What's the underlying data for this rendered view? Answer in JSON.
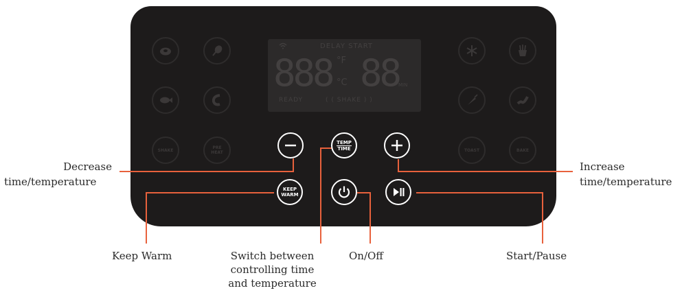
{
  "lcd": {
    "delay_start": "DELAY START",
    "temp_digits": "888",
    "unit_f": "°F",
    "unit_c": "°C",
    "time_digits": "88",
    "min": "MIN",
    "ready": "READY",
    "shake": "( ( SHAKE ) )"
  },
  "presets": {
    "shake": "SHAKE",
    "preheat_line1": "PRE",
    "preheat_line2": "HEAT",
    "toast": "TOAST",
    "bake": "BAKE"
  },
  "buttons": {
    "temp": "TEMP",
    "time": "TIME",
    "keep": "KEEP",
    "warm": "WARM"
  },
  "labels": {
    "decrease_line1": "Decrease",
    "decrease_line2": "time/temperature",
    "increase_line1": "Increase",
    "increase_line2": "time/temperature",
    "keep_warm": "Keep Warm",
    "switch_line1": "Switch between",
    "switch_line2": "controlling time",
    "switch_line3": "and temperature",
    "on_off": "On/Off",
    "start_pause": "Start/Pause"
  },
  "colors": {
    "panel": "#1d1b1b",
    "callout_line": "#e8613c",
    "button_outline": "#ffffff"
  },
  "icons": [
    "steak-icon",
    "drumstick-icon",
    "fish-icon",
    "shrimp-icon",
    "snowflake-icon",
    "fries-icon",
    "vegetable-icon",
    "bacon-icon",
    "minus-icon",
    "plus-icon",
    "power-icon",
    "play-pause-icon"
  ]
}
